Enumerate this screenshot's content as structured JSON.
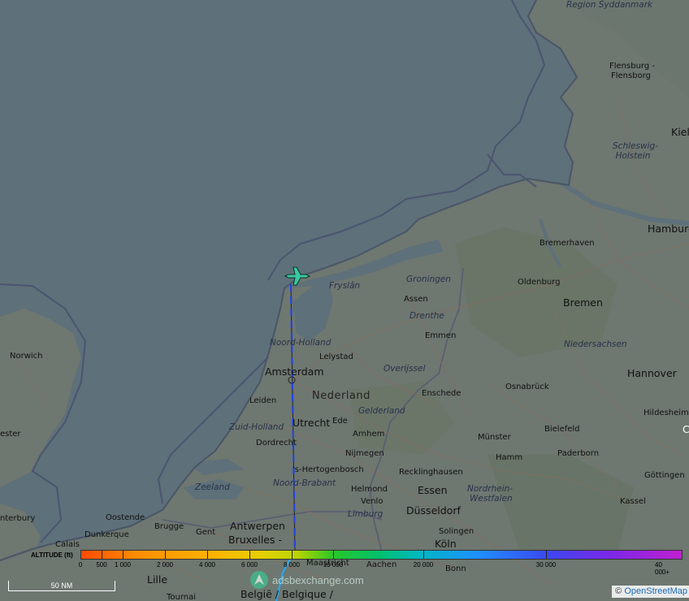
{
  "map": {
    "labels": {
      "region_syddanmark": "Region Syddanmark",
      "flensburg_1": "Flensburg -",
      "flensburg_2": "Flensborg",
      "schleswig_holstein": "Schleswig-Holstein",
      "kiel": "Kiel",
      "hamburg": "Hamburg",
      "bremerhaven": "Bremerhaven",
      "oldenburg": "Oldenburg",
      "bremen": "Bremen",
      "niedersachsen": "Niedersachsen",
      "hannover": "Hannover",
      "hildesheim": "Hildesheim",
      "groningen": "Groningen",
      "fryslan": "Fryslân",
      "assen": "Assen",
      "drenthe": "Drenthe",
      "emmen": "Emmen",
      "noord_holland": "Noord-Holland",
      "lelystad": "Lelystad",
      "amsterdam": "Amsterdam",
      "overijssel": "Overijssel",
      "nederland": "Nederland",
      "leiden": "Leiden",
      "enschede": "Enschede",
      "osnabruck": "Osnabrück",
      "gelderland": "Gelderland",
      "zuid_holland": "Zuid-Holland",
      "utrecht": "Utrecht",
      "ede": "Ede",
      "arnhem": "Arnhem",
      "bielefeld": "Bielefeld",
      "munster": "Münster",
      "dordrecht": "Dordrecht",
      "nijmegen": "Nijmegen",
      "paderborn": "Paderborn",
      "hamm": "Hamm",
      "s_hertogenbosch": "'s-Hertogenbosch",
      "recklinghausen": "Recklinghausen",
      "gottingen": "Göttingen",
      "zeeland": "Zeeland",
      "noord_brabant": "Noord-Brabant",
      "helmond": "Helmond",
      "essen": "Essen",
      "nrw_1": "Nordrhein-",
      "nrw_2": "Westfalen",
      "venlo": "Venlo",
      "kassel": "Kassel",
      "oostende": "Oostende",
      "limburg": "Limburg",
      "dusseldorf": "Düsseldorf",
      "dunkerque": "Dunkerque",
      "brugge": "Brugge",
      "gent": "Gent",
      "antwerpen": "Antwerpen",
      "solingen": "Solingen",
      "calais": "Calais",
      "bruxelles": "Bruxelles -",
      "koln": "Köln",
      "maastricht": "Maastricht",
      "aachen": "Aachen",
      "bonn": "Bonn",
      "lille": "Lille",
      "tournai": "Tournai",
      "belgie": "België / Belgique /",
      "norwich": "Norwich",
      "ester": "ester",
      "nterbury": "nterbury",
      "edge_c": "C"
    }
  },
  "legend": {
    "title": "ALTITUDE (ft)",
    "ticks": [
      "0",
      "500",
      "1 000",
      "2 000",
      "4 000",
      "6 000",
      "8 000",
      "10 000",
      "20 000",
      "30 000",
      "40 000+"
    ]
  },
  "scale_bar": {
    "label": "50 NM"
  },
  "watermark": {
    "text": "adsbexchange.com"
  },
  "attribution": {
    "prefix": "©",
    "link": "OpenStreetMap"
  },
  "track": {
    "color_main": "#2244e0",
    "color_low": "#2aa8f0",
    "aircraft_color": "#38c9a0"
  }
}
